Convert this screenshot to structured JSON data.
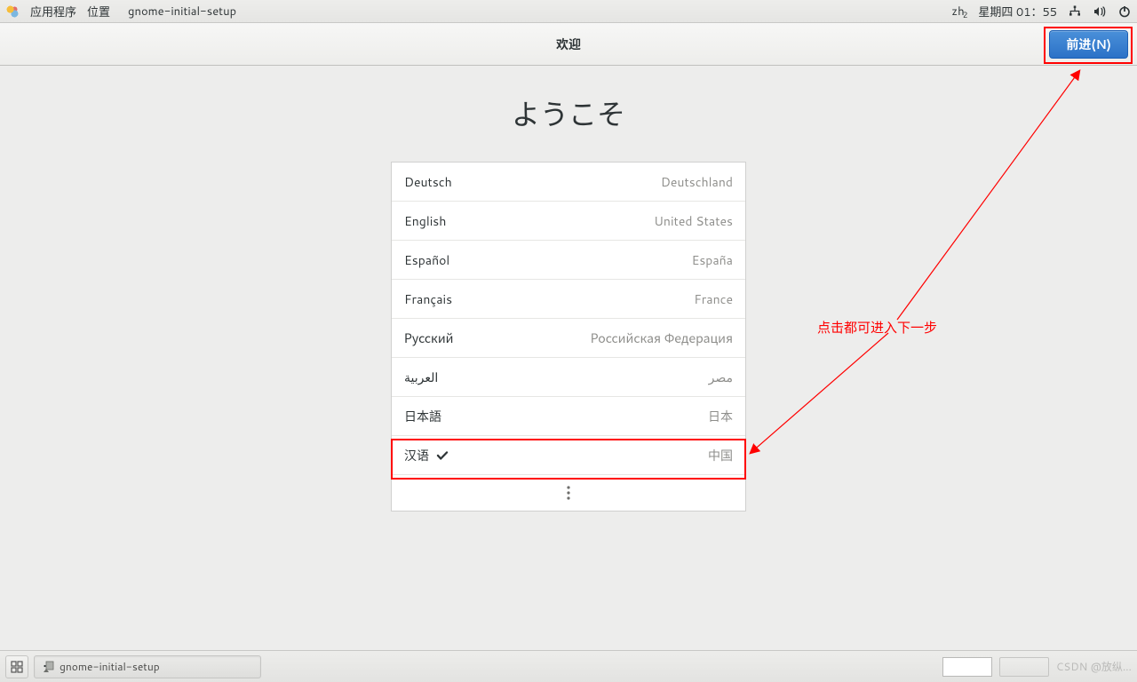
{
  "top": {
    "apps_label": "应用程序",
    "places_label": "位置",
    "app_title": "gnome-initial-setup",
    "input_ind": "zh",
    "input_ind_sub": "2",
    "date_label": "星期四 01：55"
  },
  "header": {
    "title": "欢迎",
    "next_label": "前进(N)"
  },
  "welcome": "ようこそ",
  "languages": [
    {
      "name": "Deutsch",
      "country": "Deutschland",
      "selected": false
    },
    {
      "name": "English",
      "country": "United States",
      "selected": false
    },
    {
      "name": "Español",
      "country": "España",
      "selected": false
    },
    {
      "name": "Français",
      "country": "France",
      "selected": false
    },
    {
      "name": "Русский",
      "country": "Российская Федерация",
      "selected": false
    },
    {
      "name": "العربية",
      "country": "مصر",
      "selected": false
    },
    {
      "name": "日本語",
      "country": "日本",
      "selected": false
    },
    {
      "name": "汉语",
      "country": "中国",
      "selected": true
    }
  ],
  "annotation": {
    "text": "点击都可进入下一步",
    "color": "#ff0000"
  },
  "taskbar": {
    "window_title": "gnome-initial-setup",
    "watermark": "CSDN @放纵…"
  }
}
